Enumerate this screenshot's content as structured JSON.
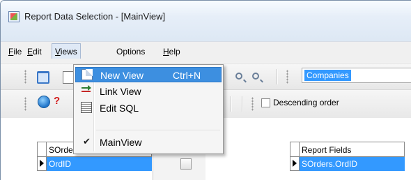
{
  "window": {
    "title": "Report Data Selection - [MainView]"
  },
  "menubar": {
    "items": [
      {
        "label_ul": "F",
        "label_rest": "ile"
      },
      {
        "label_ul": "E",
        "label_rest": "dit"
      },
      {
        "label_ul": "V",
        "label_rest": "iews"
      },
      {
        "label_ul": "",
        "label_rest": "Options"
      },
      {
        "label_ul": "H",
        "label_rest": "elp"
      }
    ]
  },
  "toolbar": {
    "combo_value": "Companies",
    "help_glyph": "?",
    "descending_label": "Descending order",
    "descending_checked": false
  },
  "views_menu": {
    "items": [
      {
        "label": "New View",
        "shortcut": "Ctrl+N",
        "icon": "new-view-icon",
        "highlighted": true
      },
      {
        "label": "Link View",
        "shortcut": "",
        "icon": "link-view-icon",
        "highlighted": false
      },
      {
        "label": "Edit SQL",
        "shortcut": "",
        "icon": "edit-sql-icon",
        "highlighted": false
      },
      {
        "label": "MainView",
        "shortcut": "",
        "icon": "checkmark-icon",
        "checked": true
      }
    ],
    "check_glyph": "✔"
  },
  "table_left": {
    "header": "SOrders",
    "rows": [
      "OrdID"
    ]
  },
  "table_right": {
    "header": "Report Fields",
    "rows": [
      "SOrders.OrdID"
    ]
  },
  "colors": {
    "selection": "#3399ff",
    "menu_highlight": "#3d8fe0"
  }
}
